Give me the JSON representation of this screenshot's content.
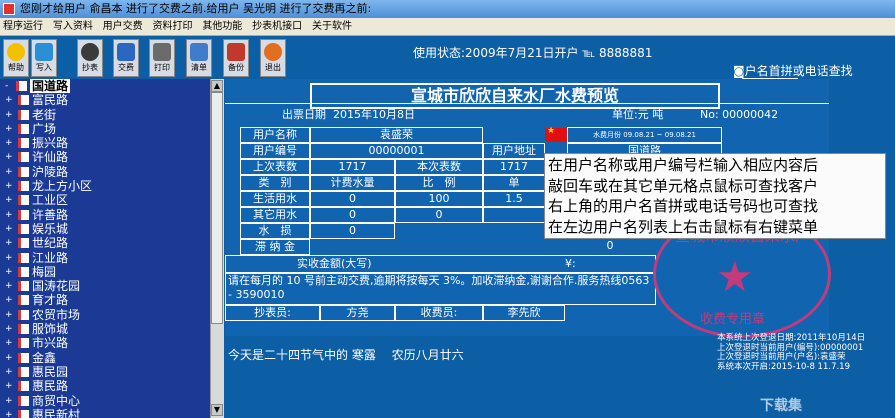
{
  "window": {
    "title": "您刚才给用户 俞昌本 进行了交费之前.给用户 吴光明 进行了交费再之前:"
  },
  "menu": [
    "程序运行",
    "写入资料",
    "用户交费",
    "资料打印",
    "其他功能",
    "抄表机接口",
    "关于软件"
  ],
  "toolbar": [
    {
      "label": "帮助",
      "icon": "help-bulb-icon",
      "color": "#f2c200"
    },
    {
      "label": "写入",
      "icon": "write-icon",
      "color": "#2b8fd6"
    },
    {
      "label": "抄表",
      "icon": "meter-read-icon",
      "color": "#3b3b3b"
    },
    {
      "label": "交费",
      "icon": "payment-icon",
      "color": "#2a67c2"
    },
    {
      "label": "打印",
      "icon": "print-icon",
      "color": "#6b6b6b"
    },
    {
      "label": "清单",
      "icon": "list-icon",
      "color": "#3f7dcc"
    },
    {
      "label": "备份",
      "icon": "backup-icon",
      "color": "#c0392b"
    },
    {
      "label": "退出",
      "icon": "exit-icon",
      "color": "#e07020"
    }
  ],
  "status": {
    "usage": "使用状态:2009年7月21日开户 ℡ 8888881"
  },
  "search": {
    "label": "◙户名首拼或电话查找"
  },
  "tree": {
    "root": "国道路",
    "items": [
      "富民路",
      "老街",
      "广场",
      "振兴路",
      "许仙路",
      "沪陵路",
      "龙上方小区",
      "工业区",
      "许善路",
      "娱乐城",
      "世纪路",
      "江业路",
      "梅园",
      "国涛花园",
      "育才路",
      "农贸市场",
      "服饰城",
      "市兴路",
      "金鑫",
      "惠民园",
      "惠民路",
      "商贸中心",
      "惠民新村"
    ]
  },
  "bill": {
    "title": "宣城市欣欣自来水厂水费预览",
    "date_label": "出票日期",
    "date": "2015年10月8日",
    "unit_label": "单位:元 吨",
    "no_label": "No:",
    "no": "00000042",
    "fee_month": "水费月份 09.08.21 ~ 09.08.21",
    "name_label": "用户名称",
    "name": "袁盛荣",
    "id_label": "用户编号",
    "id": "00000001",
    "addr_label": "用户地址",
    "addr": "国道路",
    "last_label": "上次表数",
    "last": "1717",
    "this_label": "本次表数",
    "this": "1717",
    "unit_col": "单",
    "h_type": "类　别",
    "h_water": "计费水量",
    "h_ratio": "比　例",
    "life_label": "生活用水",
    "life_water": "0",
    "life_ratio": "100",
    "life_price": "1.5",
    "other_label": "其它用水",
    "other_water": "0",
    "other_ratio": "0",
    "loss_label": "水　损",
    "loss": "0",
    "late_label": "滞 纳 金",
    "late": "0",
    "total_label": "实收金额(大写)",
    "total_sym": "¥:",
    "notice": "请在每月的 10 号前主动交费,逾期将按每天 3%。加收滞纳金,谢谢合作.服务热线0563 - 3590010",
    "reader_label": "抄表员:",
    "reader": "方尧",
    "collector_label": "收费员:",
    "collector": "李先欣"
  },
  "tooltip": [
    "在用户名称或用户编号栏输入相应内容后",
    "敲回车或在其它单元格点鼠标可查找客户",
    "右上角的用户名首拼或电话号码也可查找",
    "在左边用户名列表上右击鼠标有右键菜单"
  ],
  "seal": {
    "arc": "宣城市欣欣自来水厂",
    "bottom": "收费专用章"
  },
  "solar_term": "今天是二十四节气中的 寒露　 农历八月廿六",
  "sysinfo": [
    "本系统上次登退日期:2011年10月14日",
    "上次登退时当前用户(编号):00000001",
    "上次登退时当前用户(户名):袁盛荣",
    "系统本次开启:2015-10-8 11.7.19"
  ],
  "watermark": "下载集"
}
